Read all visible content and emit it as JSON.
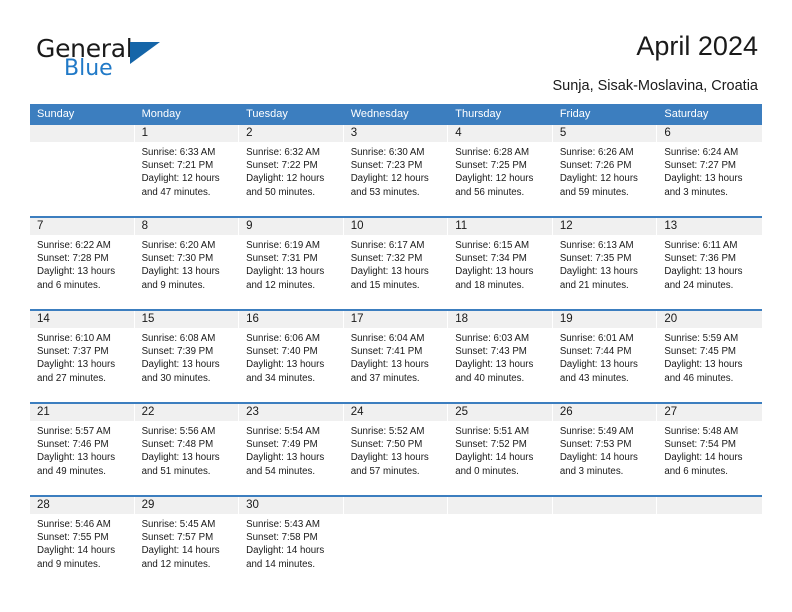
{
  "brand": {
    "name_part1": "General",
    "name_part2": "Blue",
    "accent_color": "#2079c7",
    "triangle_color": "#1565a8"
  },
  "header": {
    "title": "April 2024",
    "subtitle": "Sunja, Sisak-Moslavina, Croatia"
  },
  "calendar": {
    "header_bg": "#3c7ebf",
    "daynum_bg": "#f0f0f0",
    "weekdays": [
      "Sunday",
      "Monday",
      "Tuesday",
      "Wednesday",
      "Thursday",
      "Friday",
      "Saturday"
    ],
    "weeks": [
      [
        {
          "day": "",
          "empty": true
        },
        {
          "day": "1",
          "sunrise": "Sunrise: 6:33 AM",
          "sunset": "Sunset: 7:21 PM",
          "daylight": "Daylight: 12 hours and 47 minutes."
        },
        {
          "day": "2",
          "sunrise": "Sunrise: 6:32 AM",
          "sunset": "Sunset: 7:22 PM",
          "daylight": "Daylight: 12 hours and 50 minutes."
        },
        {
          "day": "3",
          "sunrise": "Sunrise: 6:30 AM",
          "sunset": "Sunset: 7:23 PM",
          "daylight": "Daylight: 12 hours and 53 minutes."
        },
        {
          "day": "4",
          "sunrise": "Sunrise: 6:28 AM",
          "sunset": "Sunset: 7:25 PM",
          "daylight": "Daylight: 12 hours and 56 minutes."
        },
        {
          "day": "5",
          "sunrise": "Sunrise: 6:26 AM",
          "sunset": "Sunset: 7:26 PM",
          "daylight": "Daylight: 12 hours and 59 minutes."
        },
        {
          "day": "6",
          "sunrise": "Sunrise: 6:24 AM",
          "sunset": "Sunset: 7:27 PM",
          "daylight": "Daylight: 13 hours and 3 minutes."
        }
      ],
      [
        {
          "day": "7",
          "sunrise": "Sunrise: 6:22 AM",
          "sunset": "Sunset: 7:28 PM",
          "daylight": "Daylight: 13 hours and 6 minutes."
        },
        {
          "day": "8",
          "sunrise": "Sunrise: 6:20 AM",
          "sunset": "Sunset: 7:30 PM",
          "daylight": "Daylight: 13 hours and 9 minutes."
        },
        {
          "day": "9",
          "sunrise": "Sunrise: 6:19 AM",
          "sunset": "Sunset: 7:31 PM",
          "daylight": "Daylight: 13 hours and 12 minutes."
        },
        {
          "day": "10",
          "sunrise": "Sunrise: 6:17 AM",
          "sunset": "Sunset: 7:32 PM",
          "daylight": "Daylight: 13 hours and 15 minutes."
        },
        {
          "day": "11",
          "sunrise": "Sunrise: 6:15 AM",
          "sunset": "Sunset: 7:34 PM",
          "daylight": "Daylight: 13 hours and 18 minutes."
        },
        {
          "day": "12",
          "sunrise": "Sunrise: 6:13 AM",
          "sunset": "Sunset: 7:35 PM",
          "daylight": "Daylight: 13 hours and 21 minutes."
        },
        {
          "day": "13",
          "sunrise": "Sunrise: 6:11 AM",
          "sunset": "Sunset: 7:36 PM",
          "daylight": "Daylight: 13 hours and 24 minutes."
        }
      ],
      [
        {
          "day": "14",
          "sunrise": "Sunrise: 6:10 AM",
          "sunset": "Sunset: 7:37 PM",
          "daylight": "Daylight: 13 hours and 27 minutes."
        },
        {
          "day": "15",
          "sunrise": "Sunrise: 6:08 AM",
          "sunset": "Sunset: 7:39 PM",
          "daylight": "Daylight: 13 hours and 30 minutes."
        },
        {
          "day": "16",
          "sunrise": "Sunrise: 6:06 AM",
          "sunset": "Sunset: 7:40 PM",
          "daylight": "Daylight: 13 hours and 34 minutes."
        },
        {
          "day": "17",
          "sunrise": "Sunrise: 6:04 AM",
          "sunset": "Sunset: 7:41 PM",
          "daylight": "Daylight: 13 hours and 37 minutes."
        },
        {
          "day": "18",
          "sunrise": "Sunrise: 6:03 AM",
          "sunset": "Sunset: 7:43 PM",
          "daylight": "Daylight: 13 hours and 40 minutes."
        },
        {
          "day": "19",
          "sunrise": "Sunrise: 6:01 AM",
          "sunset": "Sunset: 7:44 PM",
          "daylight": "Daylight: 13 hours and 43 minutes."
        },
        {
          "day": "20",
          "sunrise": "Sunrise: 5:59 AM",
          "sunset": "Sunset: 7:45 PM",
          "daylight": "Daylight: 13 hours and 46 minutes."
        }
      ],
      [
        {
          "day": "21",
          "sunrise": "Sunrise: 5:57 AM",
          "sunset": "Sunset: 7:46 PM",
          "daylight": "Daylight: 13 hours and 49 minutes."
        },
        {
          "day": "22",
          "sunrise": "Sunrise: 5:56 AM",
          "sunset": "Sunset: 7:48 PM",
          "daylight": "Daylight: 13 hours and 51 minutes."
        },
        {
          "day": "23",
          "sunrise": "Sunrise: 5:54 AM",
          "sunset": "Sunset: 7:49 PM",
          "daylight": "Daylight: 13 hours and 54 minutes."
        },
        {
          "day": "24",
          "sunrise": "Sunrise: 5:52 AM",
          "sunset": "Sunset: 7:50 PM",
          "daylight": "Daylight: 13 hours and 57 minutes."
        },
        {
          "day": "25",
          "sunrise": "Sunrise: 5:51 AM",
          "sunset": "Sunset: 7:52 PM",
          "daylight": "Daylight: 14 hours and 0 minutes."
        },
        {
          "day": "26",
          "sunrise": "Sunrise: 5:49 AM",
          "sunset": "Sunset: 7:53 PM",
          "daylight": "Daylight: 14 hours and 3 minutes."
        },
        {
          "day": "27",
          "sunrise": "Sunrise: 5:48 AM",
          "sunset": "Sunset: 7:54 PM",
          "daylight": "Daylight: 14 hours and 6 minutes."
        }
      ],
      [
        {
          "day": "28",
          "sunrise": "Sunrise: 5:46 AM",
          "sunset": "Sunset: 7:55 PM",
          "daylight": "Daylight: 14 hours and 9 minutes."
        },
        {
          "day": "29",
          "sunrise": "Sunrise: 5:45 AM",
          "sunset": "Sunset: 7:57 PM",
          "daylight": "Daylight: 14 hours and 12 minutes."
        },
        {
          "day": "30",
          "sunrise": "Sunrise: 5:43 AM",
          "sunset": "Sunset: 7:58 PM",
          "daylight": "Daylight: 14 hours and 14 minutes."
        },
        {
          "day": "",
          "empty": true
        },
        {
          "day": "",
          "empty": true
        },
        {
          "day": "",
          "empty": true
        },
        {
          "day": "",
          "empty": true
        }
      ]
    ]
  }
}
